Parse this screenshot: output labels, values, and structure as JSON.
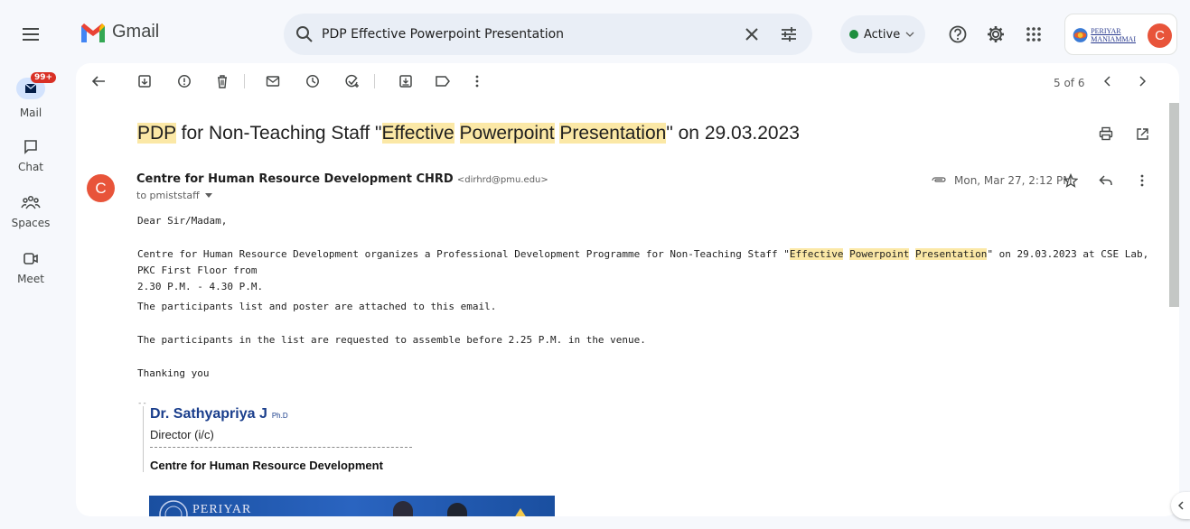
{
  "app": {
    "name": "Gmail"
  },
  "search": {
    "query": "PDP Effective Powerpoint Presentation"
  },
  "status": {
    "label": "Active"
  },
  "account": {
    "org_line1": "PERIYAR",
    "org_line2": "MANIAMMAI",
    "avatar_letter": "C"
  },
  "rail": {
    "mail_label": "Mail",
    "mail_badge": "99+",
    "chat_label": "Chat",
    "spaces_label": "Spaces",
    "meet_label": "Meet"
  },
  "toolbar": {
    "page_count": "5 of 6"
  },
  "email": {
    "subject_parts": [
      "PDP",
      " for Non-Teaching Staff \"",
      "Effective",
      " ",
      "Powerpoint",
      " ",
      "Presentation",
      "\" on 29.03.2023"
    ],
    "sender_name": "Centre for Human Resource Development CHRD",
    "sender_email": "<dirhrd@pmu.edu>",
    "sender_avatar": "C",
    "to": "to pmiststaff",
    "date": "Mon, Mar 27, 2:12 PM",
    "greeting": "Dear Sir/Madam,",
    "para1_a": "Centre for Human Resource Development organizes a Professional Development Programme for Non-Teaching Staff \"",
    "para1_h1": "Effective",
    "para1_h2": "Powerpoint",
    "para1_h3": "Presentation",
    "para1_b": "\" on 29.03.2023 at CSE Lab, PKC First Floor from",
    "para1_c": "2.30 P.M. - 4.30 P.M.",
    "para2": "The participants list and poster are attached to this email.",
    "para3": "The participants in the list are requested to assemble before 2.25 P.M. in the venue.",
    "closing": "Thanking you",
    "sig_sep": "--",
    "sig_name": "Dr. Sathyapriya J",
    "sig_degree": "Ph.D",
    "sig_title": "Director (i/c)",
    "sig_org": "Centre for Human Resource Development",
    "banner_text": "PERIYAR"
  }
}
